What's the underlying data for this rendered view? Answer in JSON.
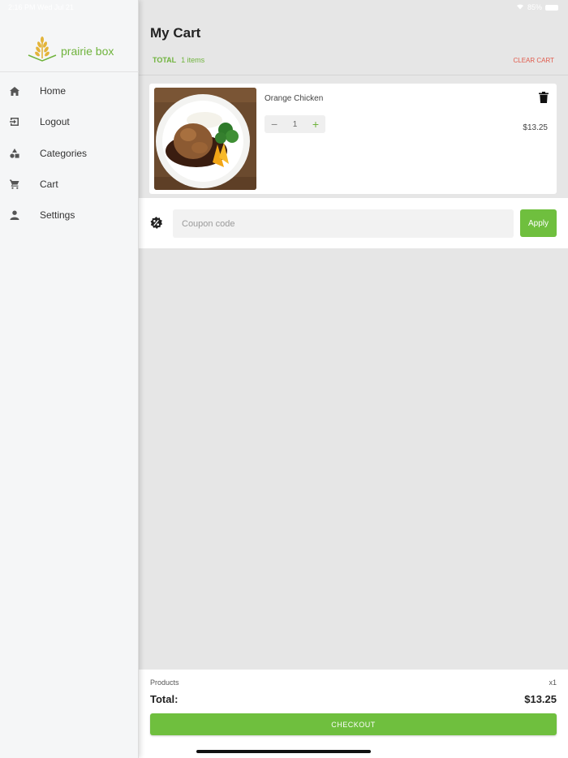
{
  "status_bar": {
    "time": "2:16 PM",
    "date": "Wed Jul 21",
    "battery": "85%"
  },
  "sidebar": {
    "logo_text": "prairie box",
    "items": [
      {
        "label": "Home",
        "icon": "home-icon"
      },
      {
        "label": "Logout",
        "icon": "logout-icon"
      },
      {
        "label": "Categories",
        "icon": "categories-icon"
      },
      {
        "label": "Cart",
        "icon": "cart-icon"
      },
      {
        "label": "Settings",
        "icon": "settings-icon"
      }
    ]
  },
  "header": {
    "title": "My Cart",
    "total_label": "TOTAL",
    "total_count": "1 items",
    "clear_label": "CLEAR CART"
  },
  "cart": {
    "items": [
      {
        "name": "Orange Chicken",
        "quantity": "1",
        "price": "$13.25",
        "minus": "−",
        "plus": "+"
      }
    ]
  },
  "coupon": {
    "placeholder": "Coupon code",
    "apply_label": "Apply"
  },
  "summary": {
    "products_label": "Products",
    "products_count": "x1",
    "total_label": "Total:",
    "total_amount": "$13.25",
    "checkout_label": "CHECKOUT"
  },
  "colors": {
    "accent": "#6fbf3e",
    "danger": "#e05a4b",
    "background": "#e6e6e6"
  }
}
